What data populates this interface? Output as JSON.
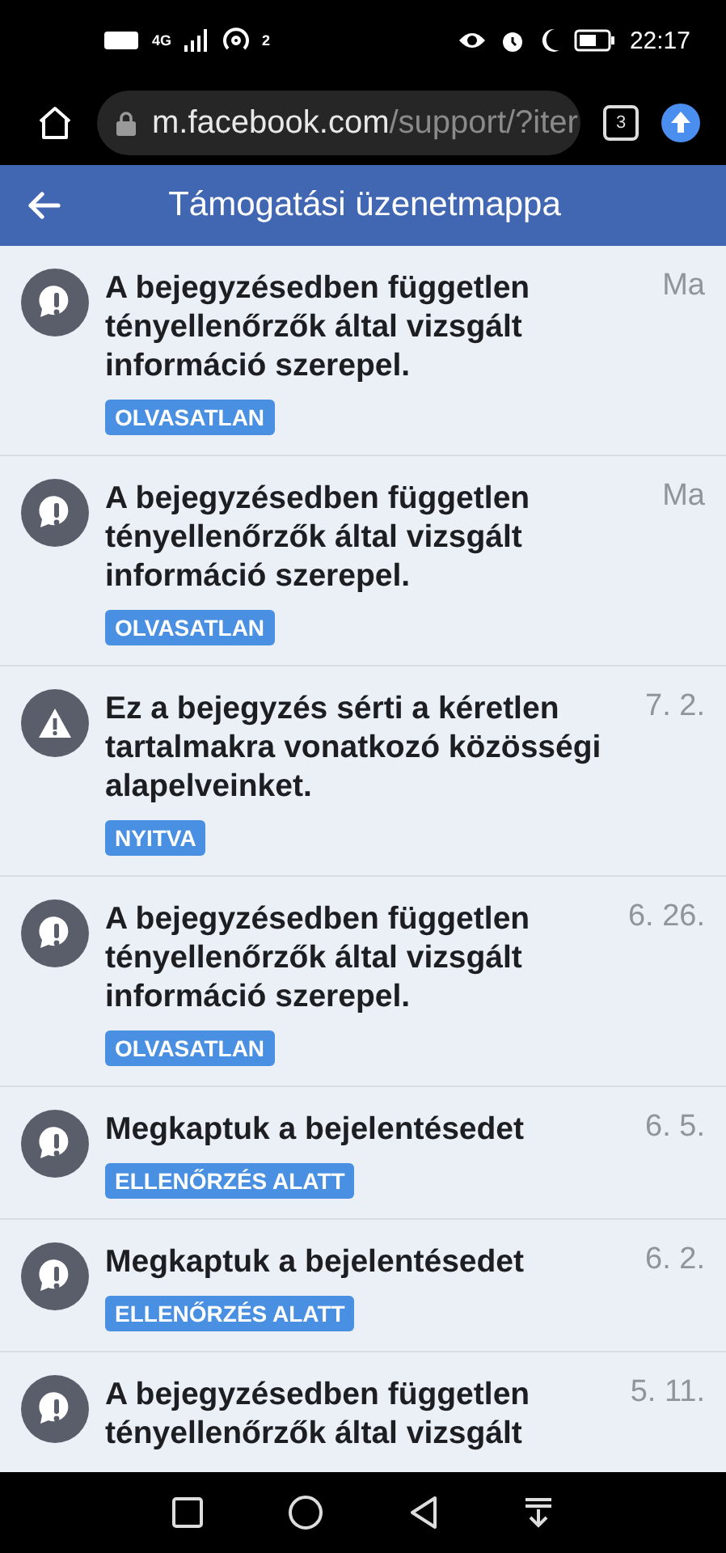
{
  "status_bar": {
    "network": "4G",
    "hotspot_count": "2",
    "time": "22:17"
  },
  "browser": {
    "url_host": "m.facebook.com",
    "url_path": "/support/?iter",
    "tab_count": "3"
  },
  "header": {
    "title": "Támogatási üzenetmappa"
  },
  "messages": [
    {
      "kind": "feedback",
      "title": "A bejegyzésedben független tényellenőrzők által vizsgált információ szerepel.",
      "date": "Ma",
      "status": "OLVASATLAN"
    },
    {
      "kind": "feedback",
      "title": "A bejegyzésedben független tényellenőrzők által vizsgált információ szerepel.",
      "date": "Ma",
      "status": "OLVASATLAN"
    },
    {
      "kind": "warning",
      "title": "Ez a bejegyzés sérti a kéretlen tartalmakra vonatkozó közösségi alapelveinket.",
      "date": "7. 2.",
      "status": "NYITVA"
    },
    {
      "kind": "feedback",
      "title": "A bejegyzésedben független tényellenőrzők által vizsgált információ szerepel.",
      "date": "6. 26.",
      "status": "OLVASATLAN"
    },
    {
      "kind": "feedback",
      "title": "Megkaptuk a bejelentésedet",
      "date": "6. 5.",
      "status": "ELLENŐRZÉS ALATT"
    },
    {
      "kind": "feedback",
      "title": "Megkaptuk a bejelentésedet",
      "date": "6. 2.",
      "status": "ELLENŐRZÉS ALATT"
    },
    {
      "kind": "feedback",
      "title": "A bejegyzésedben független tényellenőrzők által vizsgált",
      "date": "5. 11."
    }
  ]
}
